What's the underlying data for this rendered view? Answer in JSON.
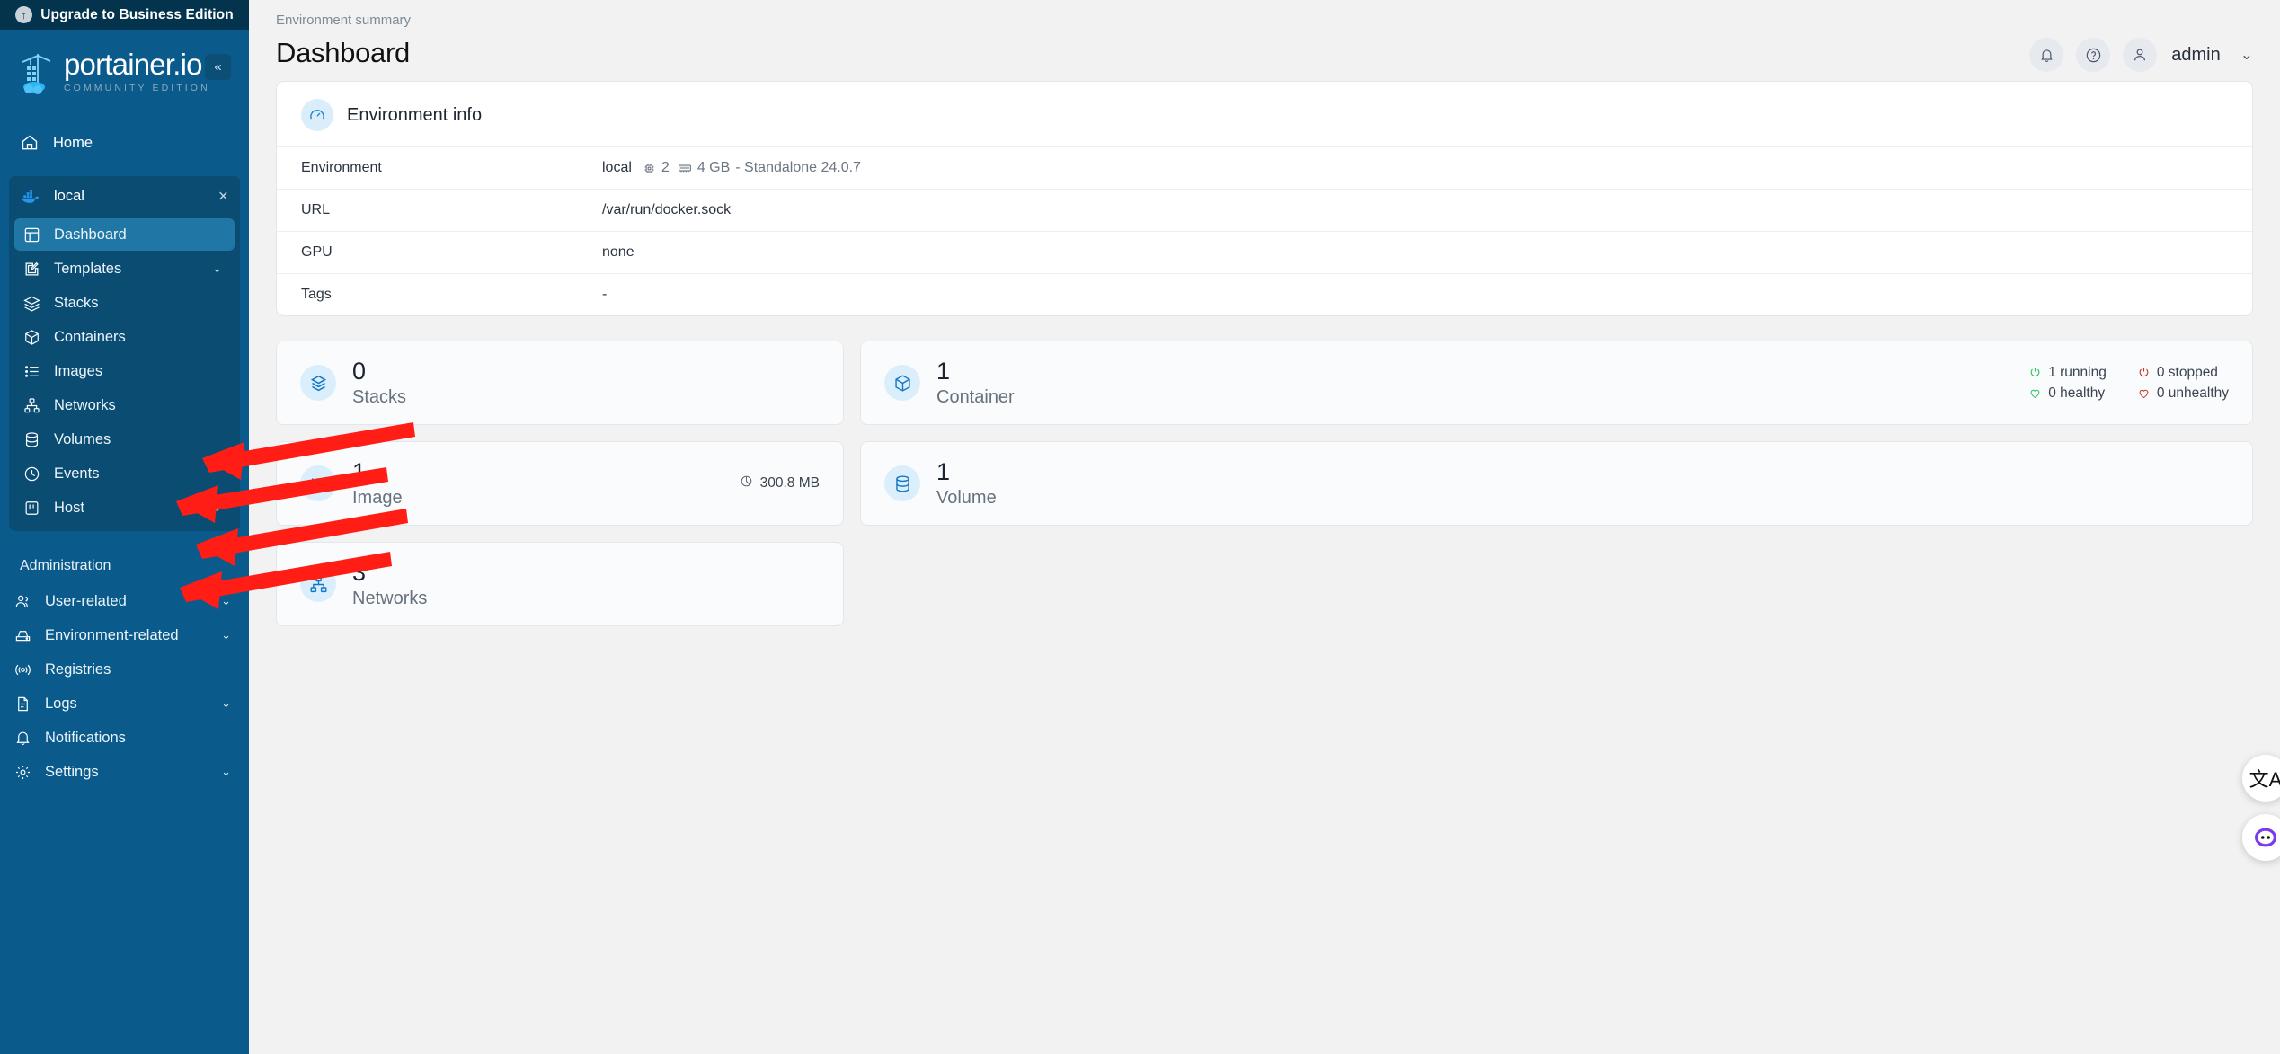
{
  "sidebar": {
    "upgrade_label": "Upgrade to Business Edition",
    "brand_name": "portainer.io",
    "brand_sub": "COMMUNITY EDITION",
    "collapse_glyph": "«",
    "home_label": "Home",
    "environment_name": "local",
    "env_close_glyph": "×",
    "items": [
      {
        "label": "Dashboard",
        "icon": "layout-icon",
        "active": true,
        "expandable": false
      },
      {
        "label": "Templates",
        "icon": "edit-square-icon",
        "active": false,
        "expandable": true
      },
      {
        "label": "Stacks",
        "icon": "layers-icon",
        "active": false,
        "expandable": false
      },
      {
        "label": "Containers",
        "icon": "box-icon",
        "active": false,
        "expandable": false
      },
      {
        "label": "Images",
        "icon": "list-icon",
        "active": false,
        "expandable": false
      },
      {
        "label": "Networks",
        "icon": "network-icon",
        "active": false,
        "expandable": false
      },
      {
        "label": "Volumes",
        "icon": "database-icon",
        "active": false,
        "expandable": false
      },
      {
        "label": "Events",
        "icon": "clock-icon",
        "active": false,
        "expandable": false
      },
      {
        "label": "Host",
        "icon": "server-icon",
        "active": false,
        "expandable": true
      }
    ],
    "admin_title": "Administration",
    "admin_items": [
      {
        "label": "User-related",
        "icon": "users-icon",
        "expandable": true
      },
      {
        "label": "Environment-related",
        "icon": "hard-drive-icon",
        "expandable": true
      },
      {
        "label": "Registries",
        "icon": "radio-icon",
        "expandable": false
      },
      {
        "label": "Logs",
        "icon": "file-text-icon",
        "expandable": true
      },
      {
        "label": "Notifications",
        "icon": "bell-icon",
        "expandable": false
      },
      {
        "label": "Settings",
        "icon": "gear-icon",
        "expandable": true
      }
    ],
    "chevron_glyph": "⌄"
  },
  "header": {
    "breadcrumb": "Environment summary",
    "title": "Dashboard",
    "user": "admin",
    "user_chevron": "⌄"
  },
  "env_info": {
    "title": "Environment info",
    "rows": [
      {
        "key": "Environment",
        "value": "local",
        "cpu": "2",
        "memory": "4 GB",
        "suffix": "- Standalone 24.0.7"
      },
      {
        "key": "URL",
        "value": "/var/run/docker.sock"
      },
      {
        "key": "GPU",
        "value": "none"
      },
      {
        "key": "Tags",
        "value": "-"
      }
    ]
  },
  "stats": {
    "stacks": {
      "count": "0",
      "label": "Stacks"
    },
    "containers": {
      "count": "1",
      "label": "Container",
      "running": "1 running",
      "stopped": "0 stopped",
      "healthy": "0 healthy",
      "unhealthy": "0 unhealthy"
    },
    "images": {
      "count": "1",
      "label": "Image",
      "size": "300.8 MB"
    },
    "volumes": {
      "count": "1",
      "label": "Volume"
    },
    "networks": {
      "count": "3",
      "label": "Networks"
    }
  },
  "colors": {
    "sidebar_bg": "#0a5b8c",
    "upgrade_bg": "#04344d",
    "active_item": "#2076a5",
    "accent_blue": "#1277c4",
    "running_green": "#22c55e",
    "stopped_red": "#c0392b",
    "arrow_red": "#ff1d16"
  },
  "floating": {
    "translate_glyph": "文A",
    "assistant_label": "assistant-bubble"
  }
}
